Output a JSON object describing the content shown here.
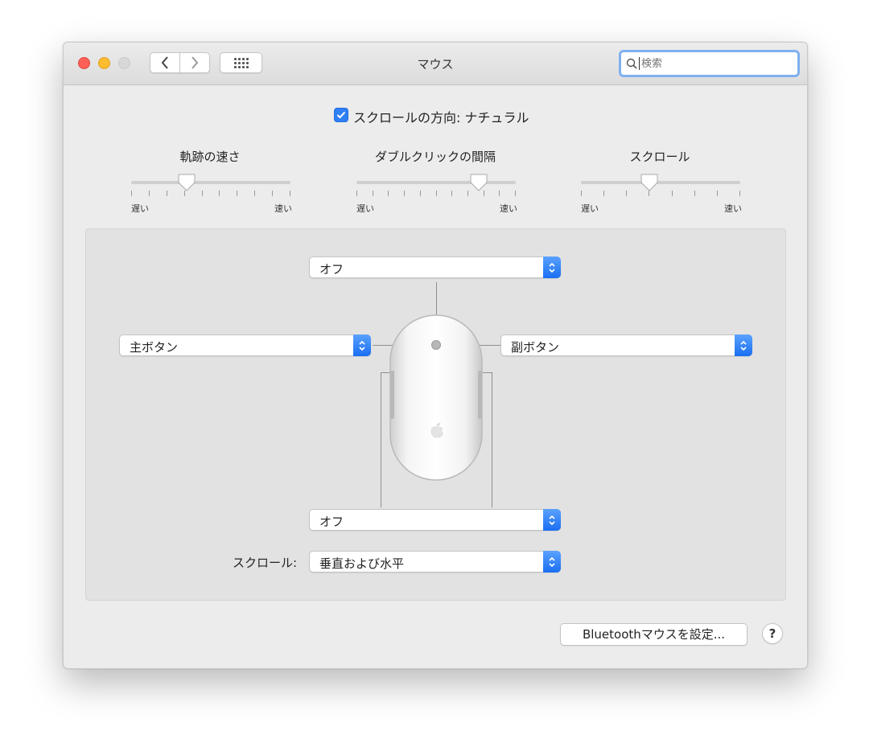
{
  "window": {
    "title": "マウス"
  },
  "toolbar": {
    "back_icon": "chevron-left-icon",
    "forward_icon": "chevron-right-icon",
    "grid_icon": "show-all-grid-icon"
  },
  "search": {
    "placeholder": "検索",
    "value": ""
  },
  "scroll_direction": {
    "label": "スクロールの方向: ナチュラル",
    "checked": true
  },
  "sliders": [
    {
      "title": "軌跡の速さ",
      "min_label": "遅い",
      "max_label": "速い",
      "tick_count": 10,
      "value": 0.35
    },
    {
      "title": "ダブルクリックの間隔",
      "min_label": "遅い",
      "max_label": "速い",
      "tick_count": 11,
      "value": 0.77
    },
    {
      "title": "スクロール",
      "min_label": "遅い",
      "max_label": "速い",
      "tick_count": 8,
      "value": 0.43
    }
  ],
  "mouse_buttons": {
    "top": "オフ",
    "left": "主ボタン",
    "right": "副ボタン",
    "bottom": "オフ"
  },
  "scroll_mode": {
    "label": "スクロール:",
    "value": "垂直および水平"
  },
  "bluetooth_button": "Bluetoothマウスを設定...",
  "help_button": "?",
  "colors": {
    "accent": "#2f7ff5",
    "close": "#fe5f57",
    "minimize": "#febc2e"
  }
}
